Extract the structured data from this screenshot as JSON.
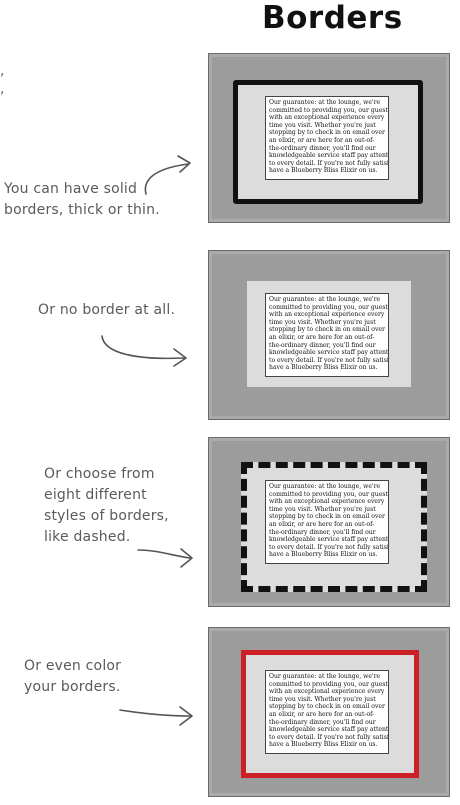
{
  "title": "Borders",
  "edge_marks": [
    ",",
    ","
  ],
  "annotations": [
    {
      "lines": [
        "You can have solid",
        "borders, thick or thin."
      ]
    },
    {
      "lines": [
        "Or no border at all."
      ]
    },
    {
      "lines": [
        "Or choose from",
        "eight different",
        "styles of borders,",
        "like dashed."
      ]
    },
    {
      "lines": [
        "Or even color",
        "your borders."
      ]
    }
  ],
  "examples": [
    {
      "border": "solid-thick",
      "border_color": "#111111"
    },
    {
      "border": "none"
    },
    {
      "border": "dashed",
      "border_color": "#111111"
    },
    {
      "border": "solid-colored",
      "border_color": "#cc2026"
    }
  ],
  "guarantee_lines": [
    "Our guarantee: at the lounge, we're",
    "committed to providing you, our guest,",
    "with an exceptional experience every",
    "time you visit. Whether you're just",
    "stopping by to check in on email over",
    "an elixir, or are here for an out-of-",
    "the-ordinary dinner, you'll find our",
    "knowledgeable service staff pay attention",
    "to every detail. If you're not fully satisfied",
    "have a Blueberry Bliss Elixir on us."
  ]
}
